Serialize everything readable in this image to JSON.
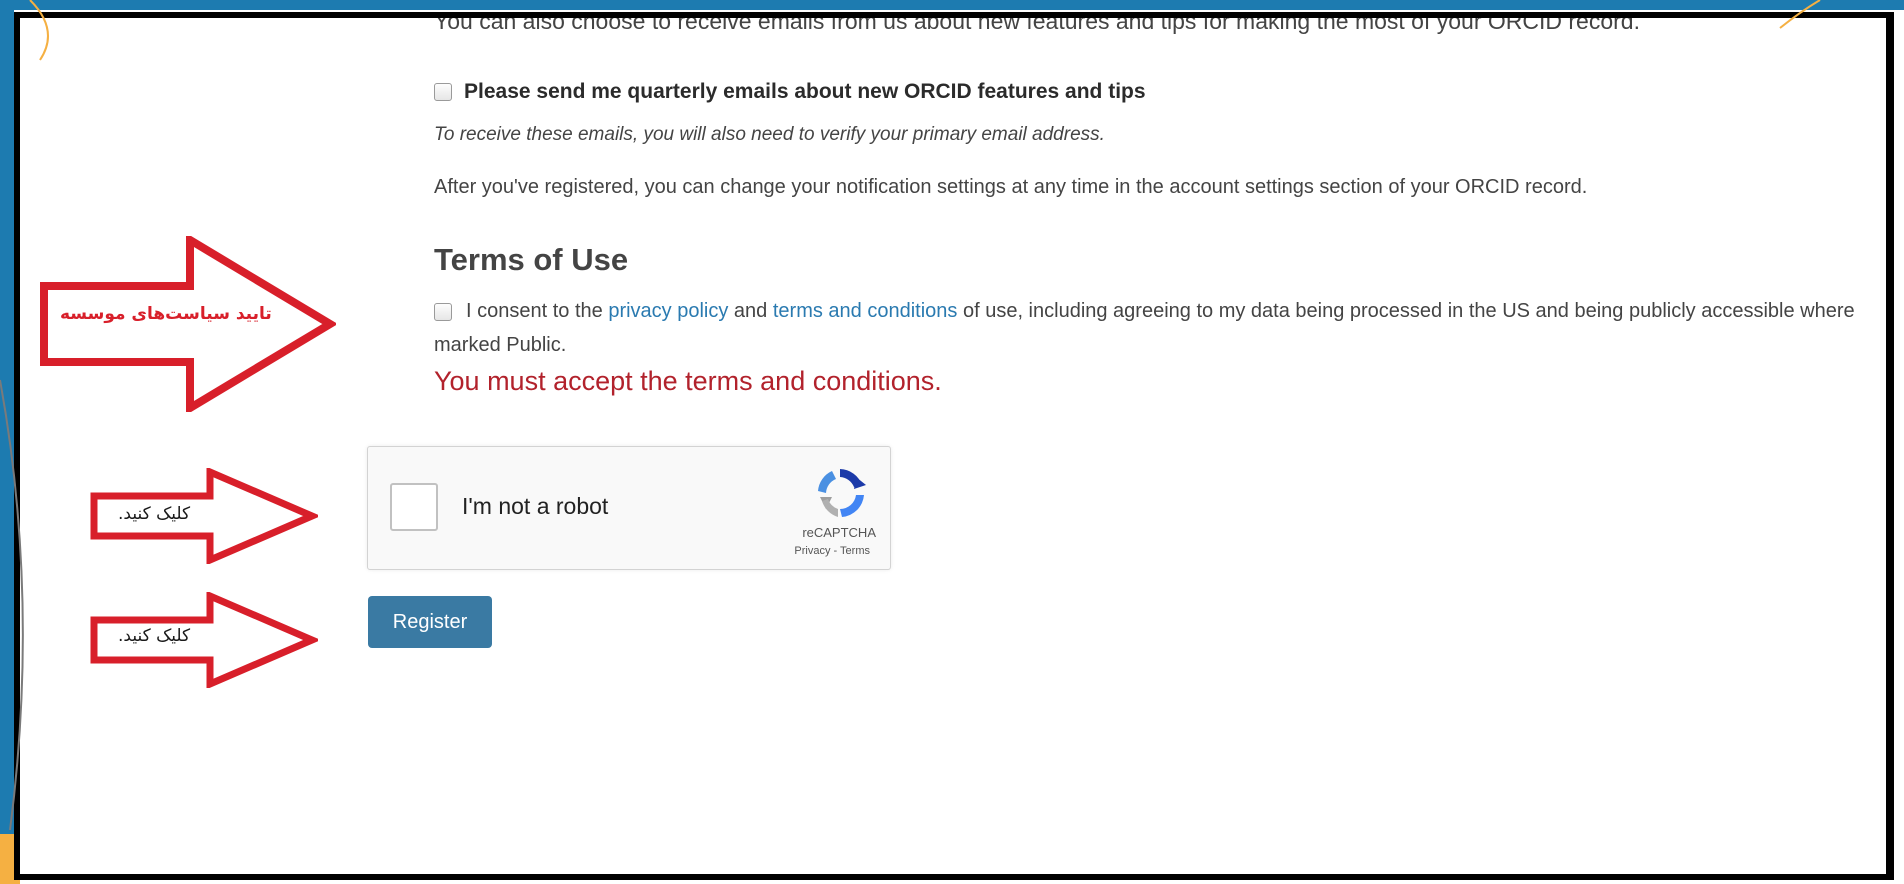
{
  "form": {
    "top_cut_text": "You can also choose to receive emails from us about new features and tips for making the most of your ORCID record.",
    "quarterly_label": "Please send me quarterly emails about new ORCID features and tips",
    "quarterly_note": "To receive these emails, you will also need to verify your primary email address.",
    "after_register_text": "After you've registered, you can change your notification settings at any time in the account settings section of your ORCID record.",
    "terms_heading": "Terms of Use",
    "consent_prefix": "I consent to the ",
    "privacy_link": "privacy policy",
    "consent_and": " and ",
    "terms_link": "terms and conditions",
    "consent_suffix": " of use, including agreeing to my data being processed in the US and being publicly accessible where marked Public.",
    "error_text": "You must accept the terms and conditions.",
    "recaptcha": {
      "label": "I'm not a robot",
      "brand": "reCAPTCHA",
      "links": "Privacy - Terms",
      "icon": "recaptcha-logo-icon"
    },
    "register_label": "Register"
  },
  "annotations": {
    "terms_arrow_text": "تایید سیاست‌های موسسه",
    "click_label_1": "کلیک کنید.",
    "click_label_2": "کلیک کنید."
  },
  "colors": {
    "slide_blue": "#1d7bb0",
    "link": "#2a7ab0",
    "error": "#b2222c",
    "button": "#3a7aa3",
    "arrow_red": "#d81f2a"
  }
}
